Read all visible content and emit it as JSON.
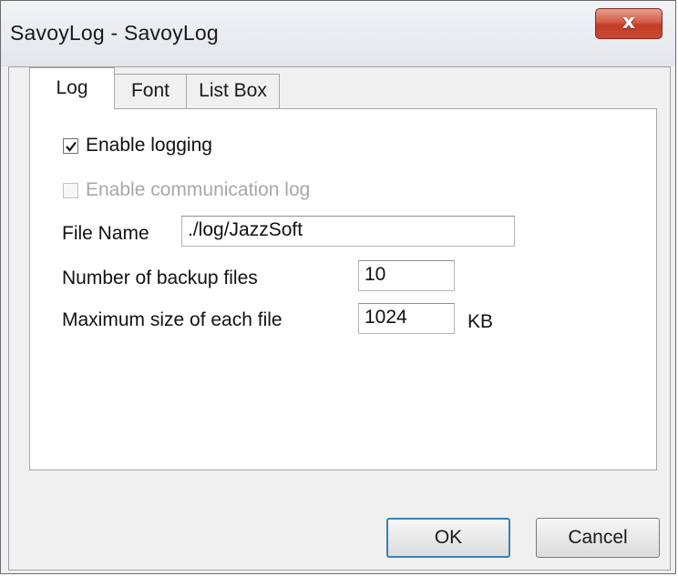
{
  "window": {
    "title": "SavoyLog - SavoyLog",
    "close_icon": "close-icon",
    "close_glyph": "x"
  },
  "tabs": [
    {
      "label": "Log",
      "active": true
    },
    {
      "label": "Font",
      "active": false
    },
    {
      "label": "List Box",
      "active": false
    }
  ],
  "log": {
    "enable_logging": {
      "label": "Enable logging",
      "checked": true,
      "enabled": true
    },
    "enable_comm_log": {
      "label": "Enable communication log",
      "checked": false,
      "enabled": false
    },
    "file_name": {
      "label": "File Name",
      "value": "./log/JazzSoft"
    },
    "backup_files": {
      "label": "Number of backup files",
      "value": "10"
    },
    "max_size": {
      "label": "Maximum size of each file",
      "value": "1024",
      "unit": "KB"
    }
  },
  "buttons": {
    "ok": "OK",
    "cancel": "Cancel"
  },
  "colors": {
    "close_button": "#c94a35",
    "default_button_border": "#3c7fb1"
  }
}
